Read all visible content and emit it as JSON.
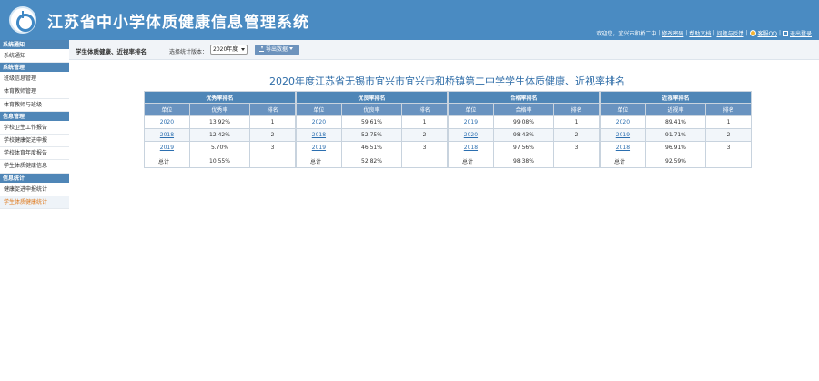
{
  "header": {
    "title": "江苏省中小学体质健康信息管理系统",
    "welcome": "欢迎您，宜兴市和桥二中",
    "links": [
      "修改密码",
      "帮助文档",
      "问题与反馈"
    ],
    "qq": "客服QQ",
    "logout": "退出登录"
  },
  "sidebar": [
    {
      "group": "系统通知",
      "items": [
        "系统通知"
      ]
    },
    {
      "group": "系统管理",
      "items": [
        "班级信息管理",
        "体育教师管理",
        "体育教师与班级"
      ]
    },
    {
      "group": "信息管理",
      "items": [
        "学校卫生工作报告",
        "学校健康促进申报",
        "学校体育年度报告",
        "学生体质健康信息"
      ]
    },
    {
      "group": "信息统计",
      "items": [
        "健康促进申报统计",
        "学生体质健康统计"
      ]
    }
  ],
  "sidebar_active": "学生体质健康统计",
  "filter": {
    "heading": "学生体质健康、近视率排名",
    "version_label": "选择统计版本：",
    "version_value": "2020年度",
    "export_label": "导出数据"
  },
  "report_title": "2020年度江苏省无锡市宜兴市宜兴市和桥镇第二中学学生体质健康、近视率排名",
  "tables": [
    {
      "caption": "优秀率排名",
      "columns": [
        "单位",
        "优秀率",
        "排名"
      ],
      "rows": [
        [
          "2020",
          "13.92%",
          "1"
        ],
        [
          "2018",
          "12.42%",
          "2"
        ],
        [
          "2019",
          "5.70%",
          "3"
        ]
      ],
      "total": [
        "总计",
        "10.55%",
        ""
      ]
    },
    {
      "caption": "优良率排名",
      "columns": [
        "单位",
        "优良率",
        "排名"
      ],
      "rows": [
        [
          "2020",
          "59.61%",
          "1"
        ],
        [
          "2018",
          "52.75%",
          "2"
        ],
        [
          "2019",
          "46.51%",
          "3"
        ]
      ],
      "total": [
        "总计",
        "52.82%",
        ""
      ]
    },
    {
      "caption": "合格率排名",
      "columns": [
        "单位",
        "合格率",
        "排名"
      ],
      "rows": [
        [
          "2019",
          "99.08%",
          "1"
        ],
        [
          "2020",
          "98.43%",
          "2"
        ],
        [
          "2018",
          "97.56%",
          "3"
        ]
      ],
      "total": [
        "总计",
        "98.38%",
        ""
      ]
    },
    {
      "caption": "近视率排名",
      "columns": [
        "单位",
        "近视率",
        "排名"
      ],
      "rows": [
        [
          "2020",
          "89.41%",
          "1"
        ],
        [
          "2019",
          "91.71%",
          "2"
        ],
        [
          "2018",
          "96.91%",
          "3"
        ]
      ],
      "total": [
        "总计",
        "92.59%",
        ""
      ]
    }
  ]
}
